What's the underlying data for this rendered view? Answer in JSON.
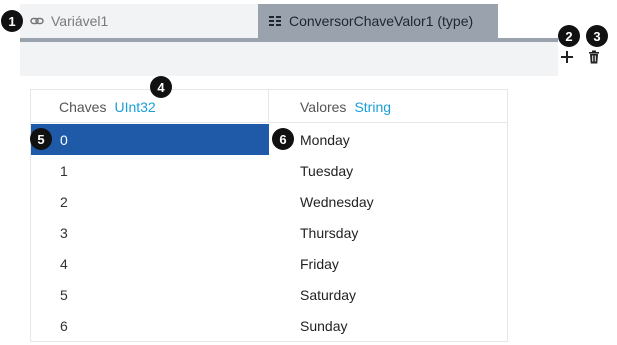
{
  "tabs": [
    {
      "label": "Variável1",
      "icon": "link-icon",
      "active": false
    },
    {
      "label": "ConversorChaveValor1 (type)",
      "icon": "key-value-icon",
      "active": true
    }
  ],
  "toolbar": {
    "add_icon": "plus-icon",
    "delete_icon": "trash-icon"
  },
  "table": {
    "key_header": "Chaves",
    "key_type": "UInt32",
    "value_header": "Valores",
    "value_type": "String",
    "rows": [
      {
        "key": "0",
        "value": "Monday",
        "selected": true
      },
      {
        "key": "1",
        "value": "Tuesday"
      },
      {
        "key": "2",
        "value": "Wednesday"
      },
      {
        "key": "3",
        "value": "Thursday"
      },
      {
        "key": "4",
        "value": "Friday"
      },
      {
        "key": "5",
        "value": "Saturday"
      },
      {
        "key": "6",
        "value": "Sunday"
      }
    ]
  },
  "callouts": [
    "1",
    "2",
    "3",
    "4",
    "5",
    "6"
  ],
  "colors": {
    "accent": "#1a9fd8",
    "selection": "#1e5aa8",
    "active_tab": "#9aa3ad"
  }
}
